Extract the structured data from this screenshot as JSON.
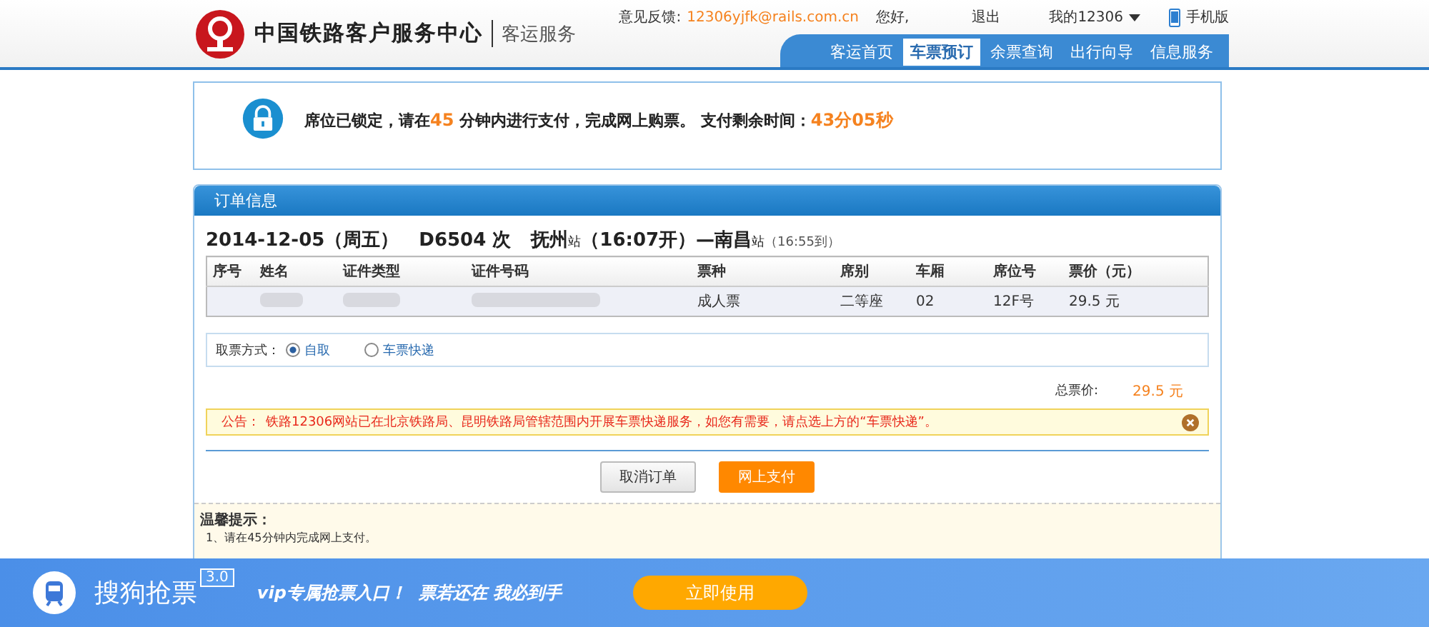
{
  "header": {
    "logo_title": "中国铁路客户服务中心",
    "logo_subtitle": "客运服务",
    "feedback_label": "意见反馈:",
    "feedback_email": "12306yjfk@rails.com.cn",
    "greeting": "您好,",
    "logout": "退出",
    "my_account": "我的12306",
    "mobile": "手机版"
  },
  "nav": [
    {
      "label": "客运首页",
      "selected": false
    },
    {
      "label": "车票预订",
      "selected": true
    },
    {
      "label": "余票查询",
      "selected": false
    },
    {
      "label": "出行向导",
      "selected": false
    },
    {
      "label": "信息服务",
      "selected": false
    }
  ],
  "lock_notice": {
    "parts": [
      {
        "text": "席位已锁定，请在",
        "highlight": false
      },
      {
        "text": "45",
        "highlight": true
      },
      {
        "text": " 分钟内进行支付，完成网上购票。 支付剩余时间：",
        "highlight": false
      },
      {
        "text": "43分05秒",
        "highlight": true
      }
    ]
  },
  "order": {
    "title": "订单信息",
    "trip": {
      "date": "2014-12-05（周五）",
      "train": "D6504 次",
      "from": "抚州",
      "from_suffix": "站",
      "depart": "（16:07开）—",
      "to": "南昌",
      "to_suffix": "站",
      "arrive": "（16:55到）"
    },
    "table": {
      "columns": [
        "序号",
        "姓名",
        "证件类型",
        "证件号码",
        "票种",
        "席别",
        "车厢",
        "席位号",
        "票价（元）"
      ],
      "rows": [
        {
          "ticket_type": "成人票",
          "seat_class": "二等座",
          "car": "02",
          "seat": "12F号",
          "price": "29.5 元"
        }
      ]
    },
    "pickup": {
      "label": "取票方式：",
      "options": [
        {
          "label": "自取",
          "selected": true
        },
        {
          "label": "车票快递",
          "selected": false
        }
      ]
    },
    "total_label": "总票价:",
    "total": "29.5 元",
    "announcement": {
      "label": "公告：",
      "text": "铁路12306网站已在北京铁路局、昆明铁路局管辖范围内开展车票快递服务，如您有需要，请点选上方的“车票快递”。"
    },
    "buttons": [
      {
        "label": "取消订单",
        "kind": "secondary"
      },
      {
        "label": "网上支付",
        "kind": "primary"
      }
    ],
    "tips": {
      "title": "温馨提示：",
      "items": [
        "1、请在45分钟内完成网上支付。"
      ]
    }
  },
  "ad_bar": {
    "name": "搜狗抢票",
    "version": "3.0",
    "slogan": "vip专属抢票入口！  票若还在 我必到手",
    "button": "立即使用"
  }
}
